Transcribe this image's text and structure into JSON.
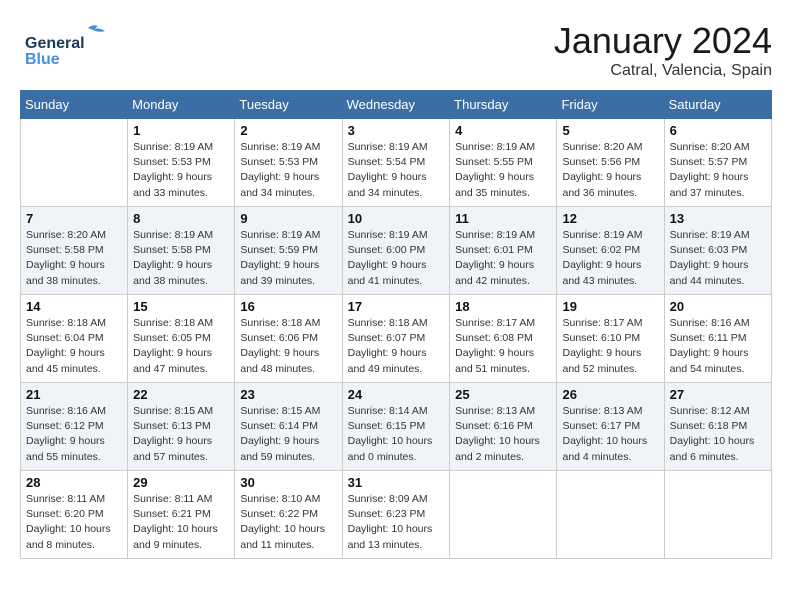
{
  "header": {
    "logo_line1": "General",
    "logo_line2": "Blue",
    "month_title": "January 2024",
    "subtitle": "Catral, Valencia, Spain"
  },
  "days_of_week": [
    "Sunday",
    "Monday",
    "Tuesday",
    "Wednesday",
    "Thursday",
    "Friday",
    "Saturday"
  ],
  "weeks": [
    [
      {
        "day": "",
        "info": ""
      },
      {
        "day": "1",
        "info": "Sunrise: 8:19 AM\nSunset: 5:53 PM\nDaylight: 9 hours\nand 33 minutes."
      },
      {
        "day": "2",
        "info": "Sunrise: 8:19 AM\nSunset: 5:53 PM\nDaylight: 9 hours\nand 34 minutes."
      },
      {
        "day": "3",
        "info": "Sunrise: 8:19 AM\nSunset: 5:54 PM\nDaylight: 9 hours\nand 34 minutes."
      },
      {
        "day": "4",
        "info": "Sunrise: 8:19 AM\nSunset: 5:55 PM\nDaylight: 9 hours\nand 35 minutes."
      },
      {
        "day": "5",
        "info": "Sunrise: 8:20 AM\nSunset: 5:56 PM\nDaylight: 9 hours\nand 36 minutes."
      },
      {
        "day": "6",
        "info": "Sunrise: 8:20 AM\nSunset: 5:57 PM\nDaylight: 9 hours\nand 37 minutes."
      }
    ],
    [
      {
        "day": "7",
        "info": "Sunrise: 8:20 AM\nSunset: 5:58 PM\nDaylight: 9 hours\nand 38 minutes."
      },
      {
        "day": "8",
        "info": "Sunrise: 8:19 AM\nSunset: 5:58 PM\nDaylight: 9 hours\nand 38 minutes."
      },
      {
        "day": "9",
        "info": "Sunrise: 8:19 AM\nSunset: 5:59 PM\nDaylight: 9 hours\nand 39 minutes."
      },
      {
        "day": "10",
        "info": "Sunrise: 8:19 AM\nSunset: 6:00 PM\nDaylight: 9 hours\nand 41 minutes."
      },
      {
        "day": "11",
        "info": "Sunrise: 8:19 AM\nSunset: 6:01 PM\nDaylight: 9 hours\nand 42 minutes."
      },
      {
        "day": "12",
        "info": "Sunrise: 8:19 AM\nSunset: 6:02 PM\nDaylight: 9 hours\nand 43 minutes."
      },
      {
        "day": "13",
        "info": "Sunrise: 8:19 AM\nSunset: 6:03 PM\nDaylight: 9 hours\nand 44 minutes."
      }
    ],
    [
      {
        "day": "14",
        "info": "Sunrise: 8:18 AM\nSunset: 6:04 PM\nDaylight: 9 hours\nand 45 minutes."
      },
      {
        "day": "15",
        "info": "Sunrise: 8:18 AM\nSunset: 6:05 PM\nDaylight: 9 hours\nand 47 minutes."
      },
      {
        "day": "16",
        "info": "Sunrise: 8:18 AM\nSunset: 6:06 PM\nDaylight: 9 hours\nand 48 minutes."
      },
      {
        "day": "17",
        "info": "Sunrise: 8:18 AM\nSunset: 6:07 PM\nDaylight: 9 hours\nand 49 minutes."
      },
      {
        "day": "18",
        "info": "Sunrise: 8:17 AM\nSunset: 6:08 PM\nDaylight: 9 hours\nand 51 minutes."
      },
      {
        "day": "19",
        "info": "Sunrise: 8:17 AM\nSunset: 6:10 PM\nDaylight: 9 hours\nand 52 minutes."
      },
      {
        "day": "20",
        "info": "Sunrise: 8:16 AM\nSunset: 6:11 PM\nDaylight: 9 hours\nand 54 minutes."
      }
    ],
    [
      {
        "day": "21",
        "info": "Sunrise: 8:16 AM\nSunset: 6:12 PM\nDaylight: 9 hours\nand 55 minutes."
      },
      {
        "day": "22",
        "info": "Sunrise: 8:15 AM\nSunset: 6:13 PM\nDaylight: 9 hours\nand 57 minutes."
      },
      {
        "day": "23",
        "info": "Sunrise: 8:15 AM\nSunset: 6:14 PM\nDaylight: 9 hours\nand 59 minutes."
      },
      {
        "day": "24",
        "info": "Sunrise: 8:14 AM\nSunset: 6:15 PM\nDaylight: 10 hours\nand 0 minutes."
      },
      {
        "day": "25",
        "info": "Sunrise: 8:13 AM\nSunset: 6:16 PM\nDaylight: 10 hours\nand 2 minutes."
      },
      {
        "day": "26",
        "info": "Sunrise: 8:13 AM\nSunset: 6:17 PM\nDaylight: 10 hours\nand 4 minutes."
      },
      {
        "day": "27",
        "info": "Sunrise: 8:12 AM\nSunset: 6:18 PM\nDaylight: 10 hours\nand 6 minutes."
      }
    ],
    [
      {
        "day": "28",
        "info": "Sunrise: 8:11 AM\nSunset: 6:20 PM\nDaylight: 10 hours\nand 8 minutes."
      },
      {
        "day": "29",
        "info": "Sunrise: 8:11 AM\nSunset: 6:21 PM\nDaylight: 10 hours\nand 9 minutes."
      },
      {
        "day": "30",
        "info": "Sunrise: 8:10 AM\nSunset: 6:22 PM\nDaylight: 10 hours\nand 11 minutes."
      },
      {
        "day": "31",
        "info": "Sunrise: 8:09 AM\nSunset: 6:23 PM\nDaylight: 10 hours\nand 13 minutes."
      },
      {
        "day": "",
        "info": ""
      },
      {
        "day": "",
        "info": ""
      },
      {
        "day": "",
        "info": ""
      }
    ]
  ]
}
